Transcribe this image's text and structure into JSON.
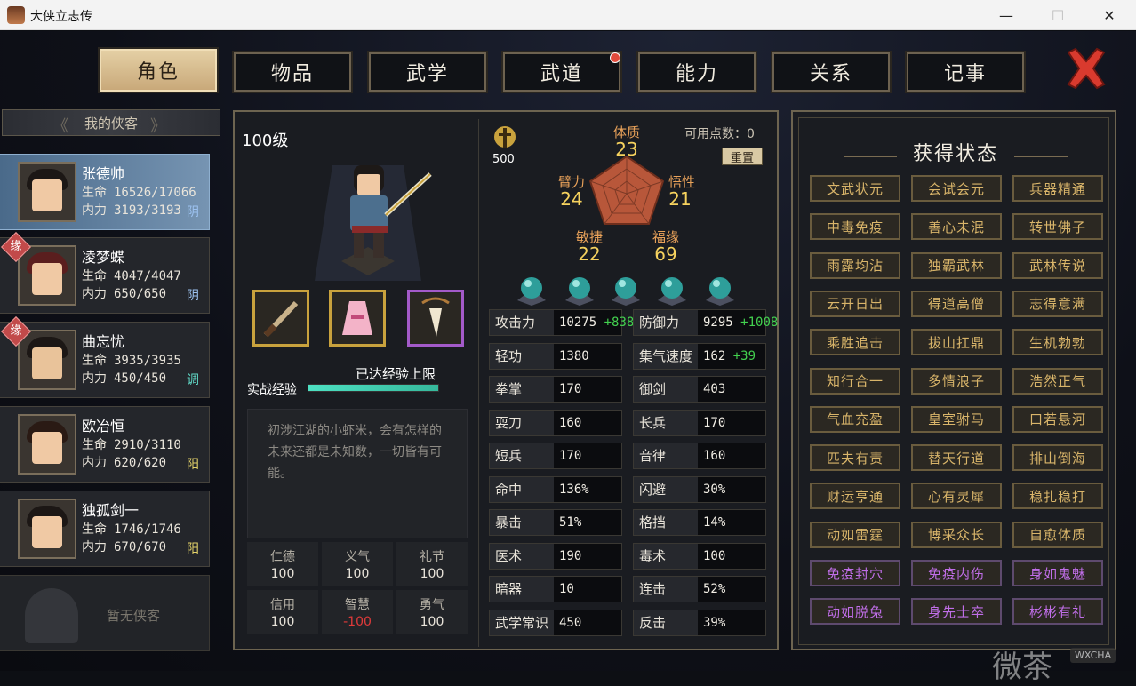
{
  "window": {
    "title": "大侠立志传",
    "minimize": "—",
    "maximize": "☐",
    "close": "✕"
  },
  "tabs": [
    {
      "label": "角色",
      "active": true
    },
    {
      "label": "物品",
      "active": false
    },
    {
      "label": "武学",
      "active": false
    },
    {
      "label": "武道",
      "active": false,
      "badge": true
    },
    {
      "label": "能力",
      "active": false
    },
    {
      "label": "关系",
      "active": false
    },
    {
      "label": "记事",
      "active": false
    }
  ],
  "sidebar": {
    "header": "我的侠客",
    "heroes": [
      {
        "name": "张德帅",
        "hp_label": "生命",
        "hp": "16526/17066",
        "mp_label": "内力",
        "mp": "3193/3193",
        "attr": "阴",
        "selected": true,
        "yuan": false
      },
      {
        "name": "凌梦蝶",
        "hp_label": "生命",
        "hp": "4047/4047",
        "mp_label": "内力",
        "mp": "650/650",
        "attr": "阴",
        "selected": false,
        "yuan": true
      },
      {
        "name": "曲忘忧",
        "hp_label": "生命",
        "hp": "3935/3935",
        "mp_label": "内力",
        "mp": "450/450",
        "attr": "调",
        "selected": false,
        "yuan": true
      },
      {
        "name": "欧冶恒",
        "hp_label": "生命",
        "hp": "2910/3110",
        "mp_label": "内力",
        "mp": "620/620",
        "attr": "阳",
        "selected": false,
        "yuan": false
      },
      {
        "name": "独孤剑一",
        "hp_label": "生命",
        "hp": "1746/1746",
        "mp_label": "内力",
        "mp": "670/670",
        "attr": "阳",
        "selected": false,
        "yuan": false
      }
    ],
    "yuan_label": "缘",
    "empty_slot": "暂无侠客"
  },
  "character": {
    "level": "100级",
    "exp_label": "实战经验",
    "exp_status": "已达经验上限",
    "exp_fraction": 1.0,
    "bio": "初涉江湖的小虾米，会有怎样的未来还都是未知数，一切皆有可能。",
    "virtues": [
      {
        "label": "仁德",
        "value": "100",
        "neg": false
      },
      {
        "label": "义气",
        "value": "100",
        "neg": false
      },
      {
        "label": "礼节",
        "value": "100",
        "neg": false
      },
      {
        "label": "信用",
        "value": "100",
        "neg": false
      },
      {
        "label": "智慧",
        "value": "-100",
        "neg": true
      },
      {
        "label": "勇气",
        "value": "100",
        "neg": false
      }
    ]
  },
  "attributes": {
    "points": "500",
    "available_label": "可用点数：0",
    "reset": "重置",
    "radar": [
      {
        "label": "体质",
        "value": "23"
      },
      {
        "label": "悟性",
        "value": "21"
      },
      {
        "label": "福缘",
        "value": "69"
      },
      {
        "label": "敏捷",
        "value": "22"
      },
      {
        "label": "臂力",
        "value": "24"
      }
    ]
  },
  "stats": [
    {
      "label": "攻击力",
      "value": "10275",
      "bonus": "+838"
    },
    {
      "label": "防御力",
      "value": "9295",
      "bonus": "+1008"
    },
    {
      "label": "轻功",
      "value": "1380",
      "bonus": ""
    },
    {
      "label": "集气速度",
      "value": "162",
      "bonus": "+39"
    },
    {
      "label": "拳掌",
      "value": "170",
      "bonus": ""
    },
    {
      "label": "御剑",
      "value": "403",
      "bonus": ""
    },
    {
      "label": "耍刀",
      "value": "160",
      "bonus": ""
    },
    {
      "label": "长兵",
      "value": "170",
      "bonus": ""
    },
    {
      "label": "短兵",
      "value": "170",
      "bonus": ""
    },
    {
      "label": "音律",
      "value": "160",
      "bonus": ""
    },
    {
      "label": "命中",
      "value": "136%",
      "bonus": ""
    },
    {
      "label": "闪避",
      "value": "30%",
      "bonus": ""
    },
    {
      "label": "暴击",
      "value": "51%",
      "bonus": ""
    },
    {
      "label": "格挡",
      "value": "14%",
      "bonus": ""
    },
    {
      "label": "医术",
      "value": "190",
      "bonus": ""
    },
    {
      "label": "毒术",
      "value": "100",
      "bonus": ""
    },
    {
      "label": "暗器",
      "value": "10",
      "bonus": ""
    },
    {
      "label": "连击",
      "value": "52%",
      "bonus": ""
    },
    {
      "label": "武学常识",
      "value": "450",
      "bonus": ""
    },
    {
      "label": "反击",
      "value": "39%",
      "bonus": ""
    }
  ],
  "status_panel": {
    "title": "获得状态",
    "chips": [
      {
        "label": "文武状元",
        "purple": false
      },
      {
        "label": "会试会元",
        "purple": false
      },
      {
        "label": "兵器精通",
        "purple": false
      },
      {
        "label": "中毒免疫",
        "purple": false
      },
      {
        "label": "善心未泯",
        "purple": false
      },
      {
        "label": "转世佛子",
        "purple": false
      },
      {
        "label": "雨露均沾",
        "purple": false
      },
      {
        "label": "独霸武林",
        "purple": false
      },
      {
        "label": "武林传说",
        "purple": false
      },
      {
        "label": "云开日出",
        "purple": false
      },
      {
        "label": "得道高僧",
        "purple": false
      },
      {
        "label": "志得意满",
        "purple": false
      },
      {
        "label": "乘胜追击",
        "purple": false
      },
      {
        "label": "拔山扛鼎",
        "purple": false
      },
      {
        "label": "生机勃勃",
        "purple": false
      },
      {
        "label": "知行合一",
        "purple": false
      },
      {
        "label": "多情浪子",
        "purple": false
      },
      {
        "label": "浩然正气",
        "purple": false
      },
      {
        "label": "气血充盈",
        "purple": false
      },
      {
        "label": "皇室驸马",
        "purple": false
      },
      {
        "label": "口若悬河",
        "purple": false
      },
      {
        "label": "匹夫有责",
        "purple": false
      },
      {
        "label": "替天行道",
        "purple": false
      },
      {
        "label": "排山倒海",
        "purple": false
      },
      {
        "label": "财运亨通",
        "purple": false
      },
      {
        "label": "心有灵犀",
        "purple": false
      },
      {
        "label": "稳扎稳打",
        "purple": false
      },
      {
        "label": "动如雷霆",
        "purple": false
      },
      {
        "label": "博采众长",
        "purple": false
      },
      {
        "label": "自愈体质",
        "purple": false
      },
      {
        "label": "免疫封穴",
        "purple": true
      },
      {
        "label": "免疫内伤",
        "purple": true
      },
      {
        "label": "身如鬼魅",
        "purple": true
      },
      {
        "label": "动如脱兔",
        "purple": true
      },
      {
        "label": "身先士卒",
        "purple": true
      },
      {
        "label": "彬彬有礼",
        "purple": true
      }
    ]
  },
  "watermark": {
    "text": "微茶",
    "badge": "WXCHA"
  },
  "colors": {
    "accent_gold": "#d9b56a",
    "purple_status": "#c06ee8",
    "bonus_green": "#43d14f",
    "negative_red": "#e03a3a"
  }
}
